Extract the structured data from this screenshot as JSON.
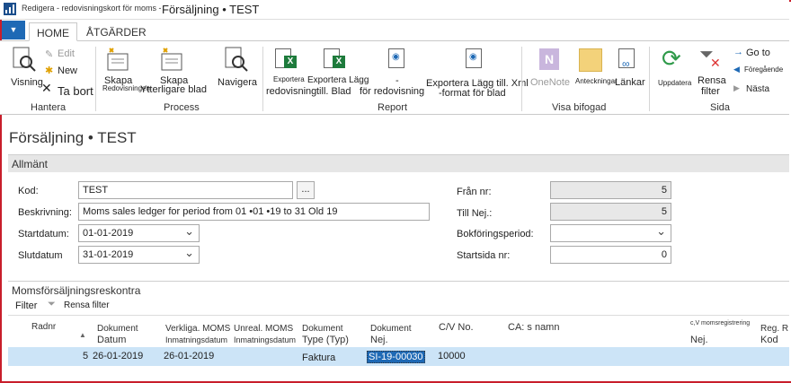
{
  "window": {
    "small_title": "Redigera - redovisningskort för moms -",
    "main_title": "Försäljning • TEST"
  },
  "tabs": [
    {
      "label": "HOME",
      "active": true
    },
    {
      "label": "ÅTGÄRDER",
      "active": false
    }
  ],
  "ribbon": {
    "hantera": {
      "group_label": "Hantera",
      "visning": "Visning",
      "edit": "Edit",
      "new": "Ny",
      "new_text": "New",
      "delete": "Ta bort"
    },
    "process": {
      "group_label": "Process",
      "skapa1": "Skapa",
      "skapa1_sub": "Redovisningen",
      "skapa2": "Skapa",
      "skapa2_sub": "Ytterligare blad",
      "navigera": "Navigera"
    },
    "report": {
      "group_label": "Report",
      "exp1_a": "Exportera",
      "exp1_b": "redovisning",
      "exp2_a": "Exportera Lägg",
      "exp2_b": "till. Blad",
      "exp3_a": "-",
      "exp3_b": "för redovisning",
      "exp4_a": "Exportera Lägg till. Xml",
      "exp4_b": "-format för blad"
    },
    "bifogad": {
      "group_label": "Visa bifogad",
      "onenote": "OneNote",
      "anteckningar": "Anteckningar",
      "lankar": "Länkar"
    },
    "sida": {
      "group_label": "Sida",
      "uppdatera": "Uppdatera",
      "rensa_a": "Rensa",
      "rensa_b": "filter",
      "goto": "Go to",
      "foregaende": "Föregående",
      "nasta": "Nästa"
    }
  },
  "page": {
    "title": "Försäljning • TEST",
    "section_general": "Allmänt",
    "fields": {
      "kod_label": "Kod:",
      "kod_value": "TEST",
      "beskrivning_label": "Beskrivning:",
      "beskrivning_value": "Moms sales ledger for period from 01 •01 •19 to 31 Old 19",
      "startdatum_label": "Startdatum:",
      "startdatum_value": "01-01-2019",
      "slutdatum_label": "Slutdatum",
      "slutdatum_value": "31-01-2019",
      "fran_nr_label": "Från nr:",
      "fran_nr_value": "5",
      "till_nej_label": "Till Nej.:",
      "till_nej_value": "5",
      "bokforingsperiod_label": "Bokföringsperiod:",
      "bokforingsperiod_value": "",
      "startsida_label": "Startsida nr:",
      "startsida_value": "0",
      "dots": "..."
    },
    "subpage_title": "Momsförsäljningsreskontra",
    "filter_label": "Filter",
    "rensa_filter": "Rensa filter"
  },
  "table": {
    "columns": [
      {
        "l1": "Radnr",
        "l2": ""
      },
      {
        "l1": "Dokument",
        "l2": "Datum"
      },
      {
        "l1": "Verkliga. MOMS",
        "l2": "Inmatningsdatum"
      },
      {
        "l1": "Unreal. MOMS",
        "l2": "Inmatningsdatum"
      },
      {
        "l1": "Dokument",
        "l2": "Type (Typ)"
      },
      {
        "l1": "Dokument",
        "l2": "Nej."
      },
      {
        "l1": "C/V No.",
        "l2": ""
      },
      {
        "l1": "CA: s namn",
        "l2": ""
      },
      {
        "l1": "c,V momsregistrering",
        "l2": "Nej."
      },
      {
        "l1": "Reg. R",
        "l2": "Kod"
      }
    ],
    "rows": [
      {
        "radnr": "5",
        "dok_datum": "26-01-2019",
        "verkliga": "26-01-2019",
        "unreal": "",
        "typ": "Faktura",
        "nej": "SI-19-00030",
        "cv_no": "10000",
        "namn": "",
        "moms_nej": "",
        "kod": ""
      }
    ]
  },
  "colors": {
    "accent": "#1e69b5",
    "border_red": "#c81e2b",
    "selected_row": "#cce4f7",
    "section_bg": "#e6e6e6"
  }
}
